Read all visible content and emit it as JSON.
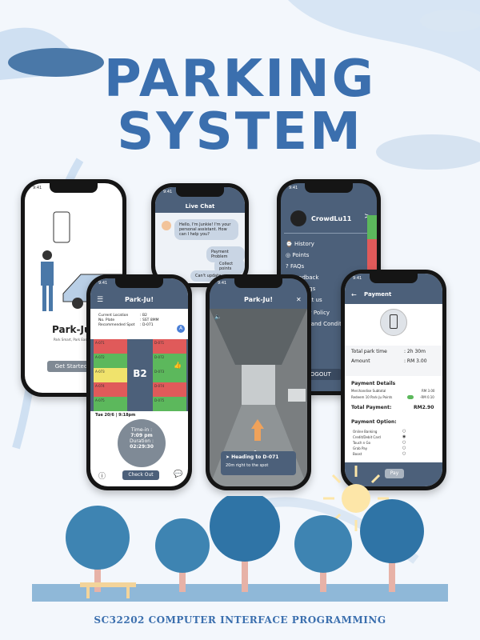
{
  "poster": {
    "title_line1": "PARKING",
    "title_line2": "SYSTEM",
    "footer": "SC32202 COMPUTER INTERFACE PROGRAMMING"
  },
  "onboarding": {
    "app_name": "Park-Ju!",
    "tagline": "Park Smart, Park Easy, ...",
    "button": "Get Started"
  },
  "live_chat": {
    "header": "Live Chat",
    "bot_message": "Hello, I'm Junkie! I'm your personal assistant. How can I help you?",
    "options": [
      "Payment Problem",
      "Collect points",
      "Can't update ..."
    ]
  },
  "menu": {
    "username": "CrowdLu11",
    "items": [
      "History",
      "Points",
      "FAQs",
      "Feedback",
      "Settings",
      "Contact us",
      "Privacy Policy",
      "Terms and Conditions"
    ],
    "logout": "LOGOUT"
  },
  "parking": {
    "header": "Park-Ju!",
    "labels": [
      "Current Location",
      "No. Plate",
      "Recommended Spot"
    ],
    "values": [
      ": B2",
      ": SST 8MM",
      ": D-071"
    ],
    "level": "B2",
    "spots_left": [
      "A-071",
      "A-072",
      "A-073",
      "A-074",
      "A-075"
    ],
    "spots_right": [
      "D-071",
      "D-072",
      "D-073",
      "D-074",
      "D-075"
    ],
    "date": "Tue 20/6 | 9:18pm",
    "time_in_label": "Time-in :",
    "time_in": "7:09 pm",
    "duration_label": "Duration :",
    "duration": "02:29:30",
    "checkout": "Check Out"
  },
  "navigation": {
    "header": "Park-Ju!",
    "heading": "Heading to D-071",
    "instruction": "20m right to the spot"
  },
  "payment": {
    "header": "Payment",
    "total_label": "Total park time",
    "total_value": ": 2h 30m",
    "amount_label": "Amount",
    "amount_value": ": RM 3.00",
    "details_title": "Payment Details",
    "merch_label": "Merchandise Subtotal",
    "merch_value": "RM 3.00",
    "redeem_label": "Redeem 10 Park-Ju Points",
    "redeem_value": "-RM 0.10",
    "total_payment_label": "Total Payment:",
    "total_payment_value": "RM2.90",
    "option_title": "Payment Option:",
    "options": [
      "Online Banking",
      "Credit/Debit Card",
      "Touch n Go",
      "Grab Pay",
      "Boost"
    ],
    "pay": "Pay"
  },
  "colors": {
    "title": "#3b6fae",
    "slate": "#4c607a",
    "red": "#e05a5a",
    "green": "#5cb85c",
    "yellow": "#f0e36c"
  }
}
